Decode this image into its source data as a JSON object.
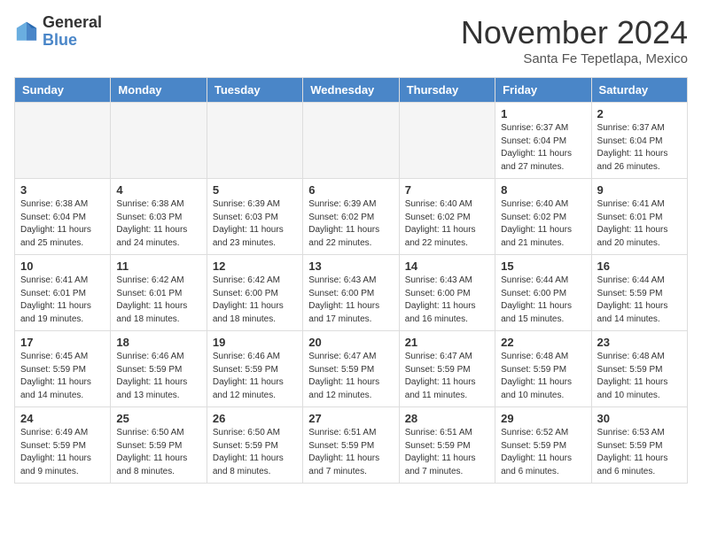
{
  "logo": {
    "line1": "General",
    "line2": "Blue"
  },
  "title": "November 2024",
  "location": "Santa Fe Tepetlapa, Mexico",
  "weekdays": [
    "Sunday",
    "Monday",
    "Tuesday",
    "Wednesday",
    "Thursday",
    "Friday",
    "Saturday"
  ],
  "weeks": [
    [
      {
        "day": "",
        "empty": true
      },
      {
        "day": "",
        "empty": true
      },
      {
        "day": "",
        "empty": true
      },
      {
        "day": "",
        "empty": true
      },
      {
        "day": "",
        "empty": true
      },
      {
        "day": "1",
        "sunrise": "Sunrise: 6:37 AM",
        "sunset": "Sunset: 6:04 PM",
        "daylight": "Daylight: 11 hours and 27 minutes."
      },
      {
        "day": "2",
        "sunrise": "Sunrise: 6:37 AM",
        "sunset": "Sunset: 6:04 PM",
        "daylight": "Daylight: 11 hours and 26 minutes."
      }
    ],
    [
      {
        "day": "3",
        "sunrise": "Sunrise: 6:38 AM",
        "sunset": "Sunset: 6:04 PM",
        "daylight": "Daylight: 11 hours and 25 minutes."
      },
      {
        "day": "4",
        "sunrise": "Sunrise: 6:38 AM",
        "sunset": "Sunset: 6:03 PM",
        "daylight": "Daylight: 11 hours and 24 minutes."
      },
      {
        "day": "5",
        "sunrise": "Sunrise: 6:39 AM",
        "sunset": "Sunset: 6:03 PM",
        "daylight": "Daylight: 11 hours and 23 minutes."
      },
      {
        "day": "6",
        "sunrise": "Sunrise: 6:39 AM",
        "sunset": "Sunset: 6:02 PM",
        "daylight": "Daylight: 11 hours and 22 minutes."
      },
      {
        "day": "7",
        "sunrise": "Sunrise: 6:40 AM",
        "sunset": "Sunset: 6:02 PM",
        "daylight": "Daylight: 11 hours and 22 minutes."
      },
      {
        "day": "8",
        "sunrise": "Sunrise: 6:40 AM",
        "sunset": "Sunset: 6:02 PM",
        "daylight": "Daylight: 11 hours and 21 minutes."
      },
      {
        "day": "9",
        "sunrise": "Sunrise: 6:41 AM",
        "sunset": "Sunset: 6:01 PM",
        "daylight": "Daylight: 11 hours and 20 minutes."
      }
    ],
    [
      {
        "day": "10",
        "sunrise": "Sunrise: 6:41 AM",
        "sunset": "Sunset: 6:01 PM",
        "daylight": "Daylight: 11 hours and 19 minutes."
      },
      {
        "day": "11",
        "sunrise": "Sunrise: 6:42 AM",
        "sunset": "Sunset: 6:01 PM",
        "daylight": "Daylight: 11 hours and 18 minutes."
      },
      {
        "day": "12",
        "sunrise": "Sunrise: 6:42 AM",
        "sunset": "Sunset: 6:00 PM",
        "daylight": "Daylight: 11 hours and 18 minutes."
      },
      {
        "day": "13",
        "sunrise": "Sunrise: 6:43 AM",
        "sunset": "Sunset: 6:00 PM",
        "daylight": "Daylight: 11 hours and 17 minutes."
      },
      {
        "day": "14",
        "sunrise": "Sunrise: 6:43 AM",
        "sunset": "Sunset: 6:00 PM",
        "daylight": "Daylight: 11 hours and 16 minutes."
      },
      {
        "day": "15",
        "sunrise": "Sunrise: 6:44 AM",
        "sunset": "Sunset: 6:00 PM",
        "daylight": "Daylight: 11 hours and 15 minutes."
      },
      {
        "day": "16",
        "sunrise": "Sunrise: 6:44 AM",
        "sunset": "Sunset: 5:59 PM",
        "daylight": "Daylight: 11 hours and 14 minutes."
      }
    ],
    [
      {
        "day": "17",
        "sunrise": "Sunrise: 6:45 AM",
        "sunset": "Sunset: 5:59 PM",
        "daylight": "Daylight: 11 hours and 14 minutes."
      },
      {
        "day": "18",
        "sunrise": "Sunrise: 6:46 AM",
        "sunset": "Sunset: 5:59 PM",
        "daylight": "Daylight: 11 hours and 13 minutes."
      },
      {
        "day": "19",
        "sunrise": "Sunrise: 6:46 AM",
        "sunset": "Sunset: 5:59 PM",
        "daylight": "Daylight: 11 hours and 12 minutes."
      },
      {
        "day": "20",
        "sunrise": "Sunrise: 6:47 AM",
        "sunset": "Sunset: 5:59 PM",
        "daylight": "Daylight: 11 hours and 12 minutes."
      },
      {
        "day": "21",
        "sunrise": "Sunrise: 6:47 AM",
        "sunset": "Sunset: 5:59 PM",
        "daylight": "Daylight: 11 hours and 11 minutes."
      },
      {
        "day": "22",
        "sunrise": "Sunrise: 6:48 AM",
        "sunset": "Sunset: 5:59 PM",
        "daylight": "Daylight: 11 hours and 10 minutes."
      },
      {
        "day": "23",
        "sunrise": "Sunrise: 6:48 AM",
        "sunset": "Sunset: 5:59 PM",
        "daylight": "Daylight: 11 hours and 10 minutes."
      }
    ],
    [
      {
        "day": "24",
        "sunrise": "Sunrise: 6:49 AM",
        "sunset": "Sunset: 5:59 PM",
        "daylight": "Daylight: 11 hours and 9 minutes."
      },
      {
        "day": "25",
        "sunrise": "Sunrise: 6:50 AM",
        "sunset": "Sunset: 5:59 PM",
        "daylight": "Daylight: 11 hours and 8 minutes."
      },
      {
        "day": "26",
        "sunrise": "Sunrise: 6:50 AM",
        "sunset": "Sunset: 5:59 PM",
        "daylight": "Daylight: 11 hours and 8 minutes."
      },
      {
        "day": "27",
        "sunrise": "Sunrise: 6:51 AM",
        "sunset": "Sunset: 5:59 PM",
        "daylight": "Daylight: 11 hours and 7 minutes."
      },
      {
        "day": "28",
        "sunrise": "Sunrise: 6:51 AM",
        "sunset": "Sunset: 5:59 PM",
        "daylight": "Daylight: 11 hours and 7 minutes."
      },
      {
        "day": "29",
        "sunrise": "Sunrise: 6:52 AM",
        "sunset": "Sunset: 5:59 PM",
        "daylight": "Daylight: 11 hours and 6 minutes."
      },
      {
        "day": "30",
        "sunrise": "Sunrise: 6:53 AM",
        "sunset": "Sunset: 5:59 PM",
        "daylight": "Daylight: 11 hours and 6 minutes."
      }
    ]
  ]
}
